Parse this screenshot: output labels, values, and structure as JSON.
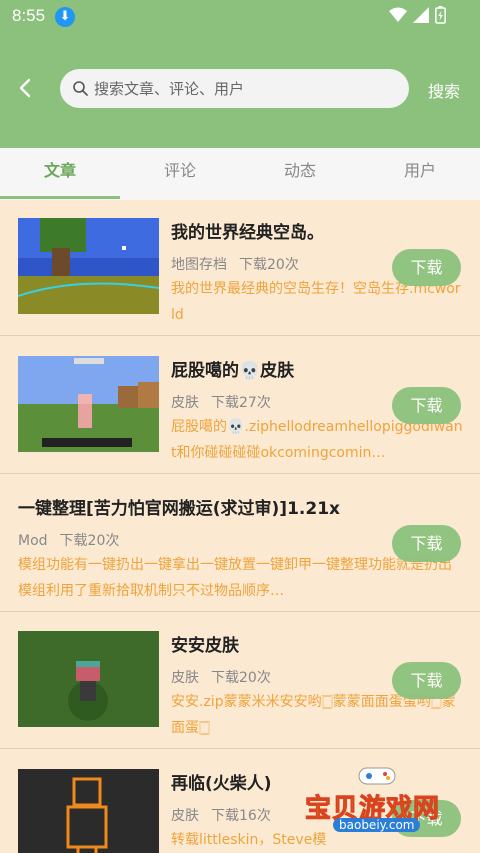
{
  "status": {
    "time": "8:55"
  },
  "search": {
    "placeholder": "搜索文章、评论、用户",
    "button": "搜索"
  },
  "tabs": [
    {
      "label": "文章"
    },
    {
      "label": "评论"
    },
    {
      "label": "动态"
    },
    {
      "label": "用户"
    }
  ],
  "download_label": "下载",
  "items": [
    {
      "title": "我的世界经典空岛。",
      "category": "地图存档",
      "downloads": "下载20次",
      "desc": "我的世界最经典的空岛生存！空岛生存.mcworld"
    },
    {
      "title": "屁股噶的💀皮肤",
      "category": "皮肤",
      "downloads": "下载27次",
      "desc": "屁股噶的💀.ziphellodreamhellopiggodiwant和你碰碰碰碰okcomingcomin…"
    },
    {
      "title": "一键整理[苦力怕官网搬运(求过审)]1.21x",
      "category": "Mod",
      "downloads": "下载20次",
      "desc": "模组功能有一键扔出一键拿出一键放置一键卸甲一键整理功能就是扔出模组利用了重新拾取机制只不过物品顺序…"
    },
    {
      "title": "安安皮肤",
      "category": "皮肤",
      "downloads": "下载20次",
      "desc": "安安.zip蒙蒙米米安安哟🀆蒙蒙面面蛋蛋哟🀆蒙面蛋🀆"
    },
    {
      "title": "再临(火柴人)",
      "category": "皮肤",
      "downloads": "下载16次",
      "desc": "转载littleskin，Steve模"
    }
  ],
  "watermark": {
    "text": "宝贝游戏网",
    "url": "baobeiy.com"
  }
}
